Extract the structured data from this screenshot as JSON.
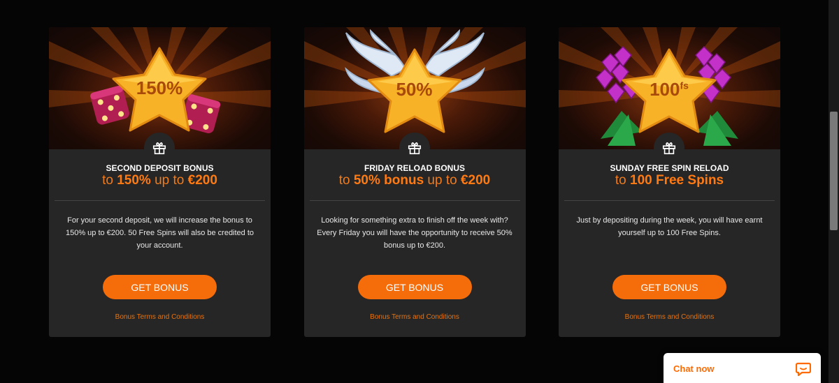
{
  "cards": [
    {
      "badge_text": "150%",
      "art": "dice",
      "title": "SECOND DEPOSIT BONUS",
      "subtitle_pre": "to ",
      "subtitle_hl1": "150%",
      "subtitle_mid": " up to ",
      "subtitle_hl2": "€200",
      "description": "For your second deposit, we will increase the bonus to 150% up to €200. 50 Free Spins will also be credited to your account.",
      "button": "GET BONUS",
      "terms": "Bonus Terms and Conditions"
    },
    {
      "badge_text": "50%",
      "art": "wings",
      "title": "FRIDAY RELOAD BONUS",
      "subtitle_pre": "to ",
      "subtitle_hl1": "50% bonus",
      "subtitle_mid": " up to ",
      "subtitle_hl2": "€200",
      "description": "Looking for something extra to finish off the week with? Every Friday you will have the opportunity to receive 50% bonus up to €200.",
      "button": "GET BONUS",
      "terms": "Bonus Terms and Conditions"
    },
    {
      "badge_text": "100",
      "badge_sup": "fs",
      "art": "gems",
      "title": "SUNDAY FREE SPIN RELOAD",
      "subtitle_pre": "to ",
      "subtitle_hl1": "100 Free Spins",
      "subtitle_mid": "",
      "subtitle_hl2": "",
      "description": "Just by depositing during the week, you will have earnt yourself up to 100 Free Spins.",
      "button": "GET BONUS",
      "terms": "Bonus Terms and Conditions"
    }
  ],
  "chat": {
    "label": "Chat now",
    "icon": "chat-bubble-icon"
  },
  "colors": {
    "accent": "#f56c0a",
    "card_bg": "#262626",
    "page_bg": "#050505"
  }
}
